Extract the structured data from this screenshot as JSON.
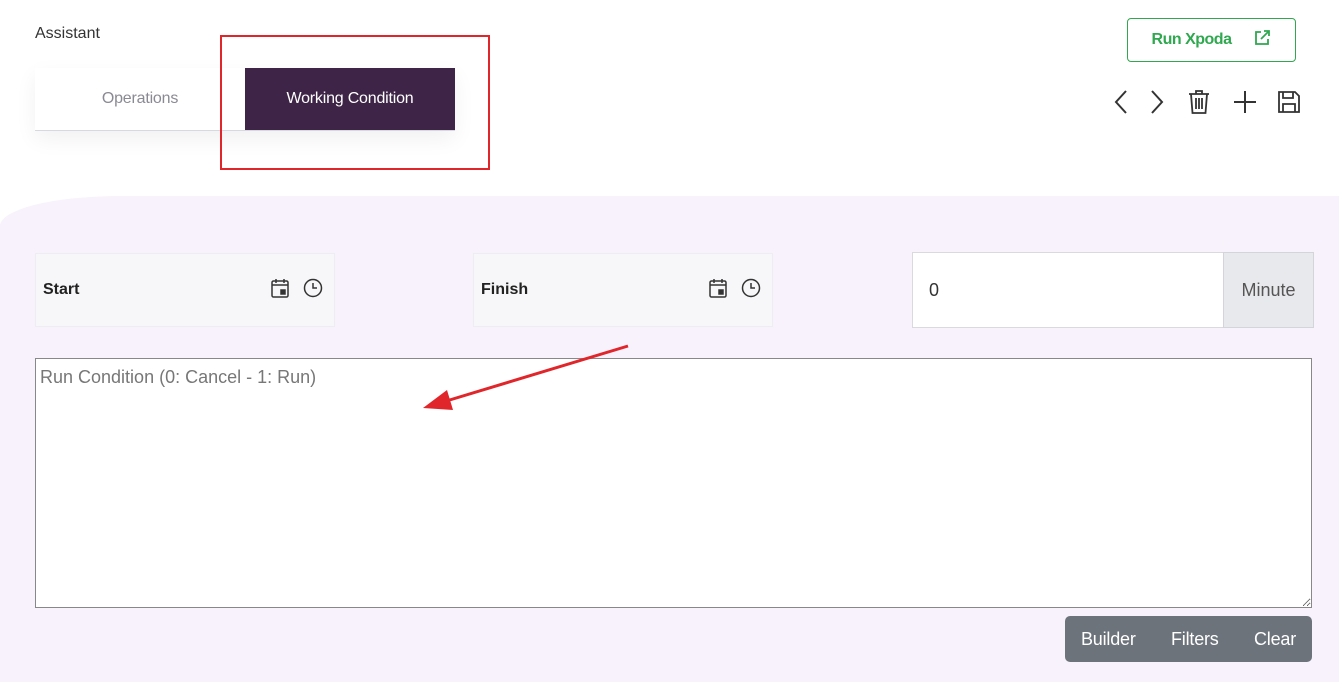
{
  "breadcrumb": "Assistant",
  "tabs": [
    {
      "label": "Operations",
      "active": false
    },
    {
      "label": "Working Condition",
      "active": true
    }
  ],
  "run_button": {
    "label": "Run Xpoda",
    "icon": "external-link-icon"
  },
  "toolbar": {
    "icons": [
      "chevron-left-icon",
      "chevron-right-icon",
      "trash-icon",
      "plus-icon",
      "save-icon"
    ]
  },
  "start": {
    "label": "Start",
    "icons": [
      "calendar-icon",
      "clock-icon"
    ]
  },
  "finish": {
    "label": "Finish",
    "icons": [
      "calendar-icon",
      "clock-icon"
    ]
  },
  "duration": {
    "value": "0",
    "unit": "Minute"
  },
  "condition": {
    "placeholder": "Run Condition (0: Cancel - 1: Run)",
    "value": ""
  },
  "actions": {
    "builder": "Builder",
    "filters": "Filters",
    "clear": "Clear"
  },
  "colors": {
    "active_tab": "#3e2547",
    "run_green": "#2fa84f",
    "highlight_red": "#e0262a",
    "panel_bg": "#f8f2fc",
    "button_group": "#6c737b"
  }
}
